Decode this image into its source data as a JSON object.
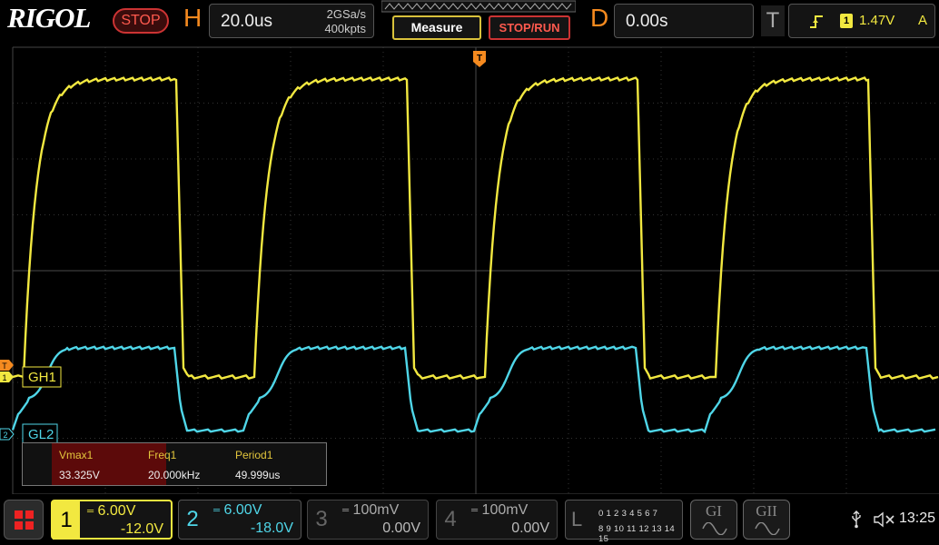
{
  "brand": "RIGOL",
  "run_status": "STOP",
  "horizontal": {
    "label": "H",
    "timebase": "20.0us",
    "sample_rate": "2GSa/s",
    "memory_depth": "400kpts"
  },
  "measure_label": "Measure",
  "stoprun_label": "STOP/RUN",
  "delay": {
    "label": "D",
    "value": "0.00s"
  },
  "trigger": {
    "label": "T",
    "source": "1",
    "level": "1.47V",
    "mode": "A"
  },
  "markers": {
    "trigger_top": "T",
    "trigger_left": "T",
    "ch1_index": "1",
    "ch2_index": "2"
  },
  "channel_labels": {
    "ch1": "GH1",
    "ch2": "GL2"
  },
  "measurements": [
    {
      "name": "Vmax1",
      "value": "33.325V"
    },
    {
      "name": "Freq1",
      "value": "20.000kHz"
    },
    {
      "name": "Period1",
      "value": "49.999us"
    }
  ],
  "channels": [
    {
      "number": "1",
      "scale": "6.00V",
      "offset": "-12.0V",
      "color": "#f2e840",
      "active": true
    },
    {
      "number": "2",
      "scale": "6.00V",
      "offset": "-18.0V",
      "color": "#4fd6e8",
      "active": true
    },
    {
      "number": "3",
      "scale": "100mV",
      "offset": "0.00V",
      "color": "#555555",
      "active": false
    },
    {
      "number": "4",
      "scale": "100mV",
      "offset": "0.00V",
      "color": "#555555",
      "active": false
    }
  ],
  "logic": {
    "label": "L",
    "row1": "0 1 2 3   4 5 6 7",
    "row2": "8 9 10 11 12 13 14 15"
  },
  "generators": [
    {
      "label": "GI"
    },
    {
      "label": "GII"
    }
  ],
  "time": "13:25",
  "colors": {
    "accent_orange": "#f58a1f",
    "ch1": "#f2e840",
    "ch2": "#4fd6e8",
    "stop_red": "#ff5a4e"
  }
}
